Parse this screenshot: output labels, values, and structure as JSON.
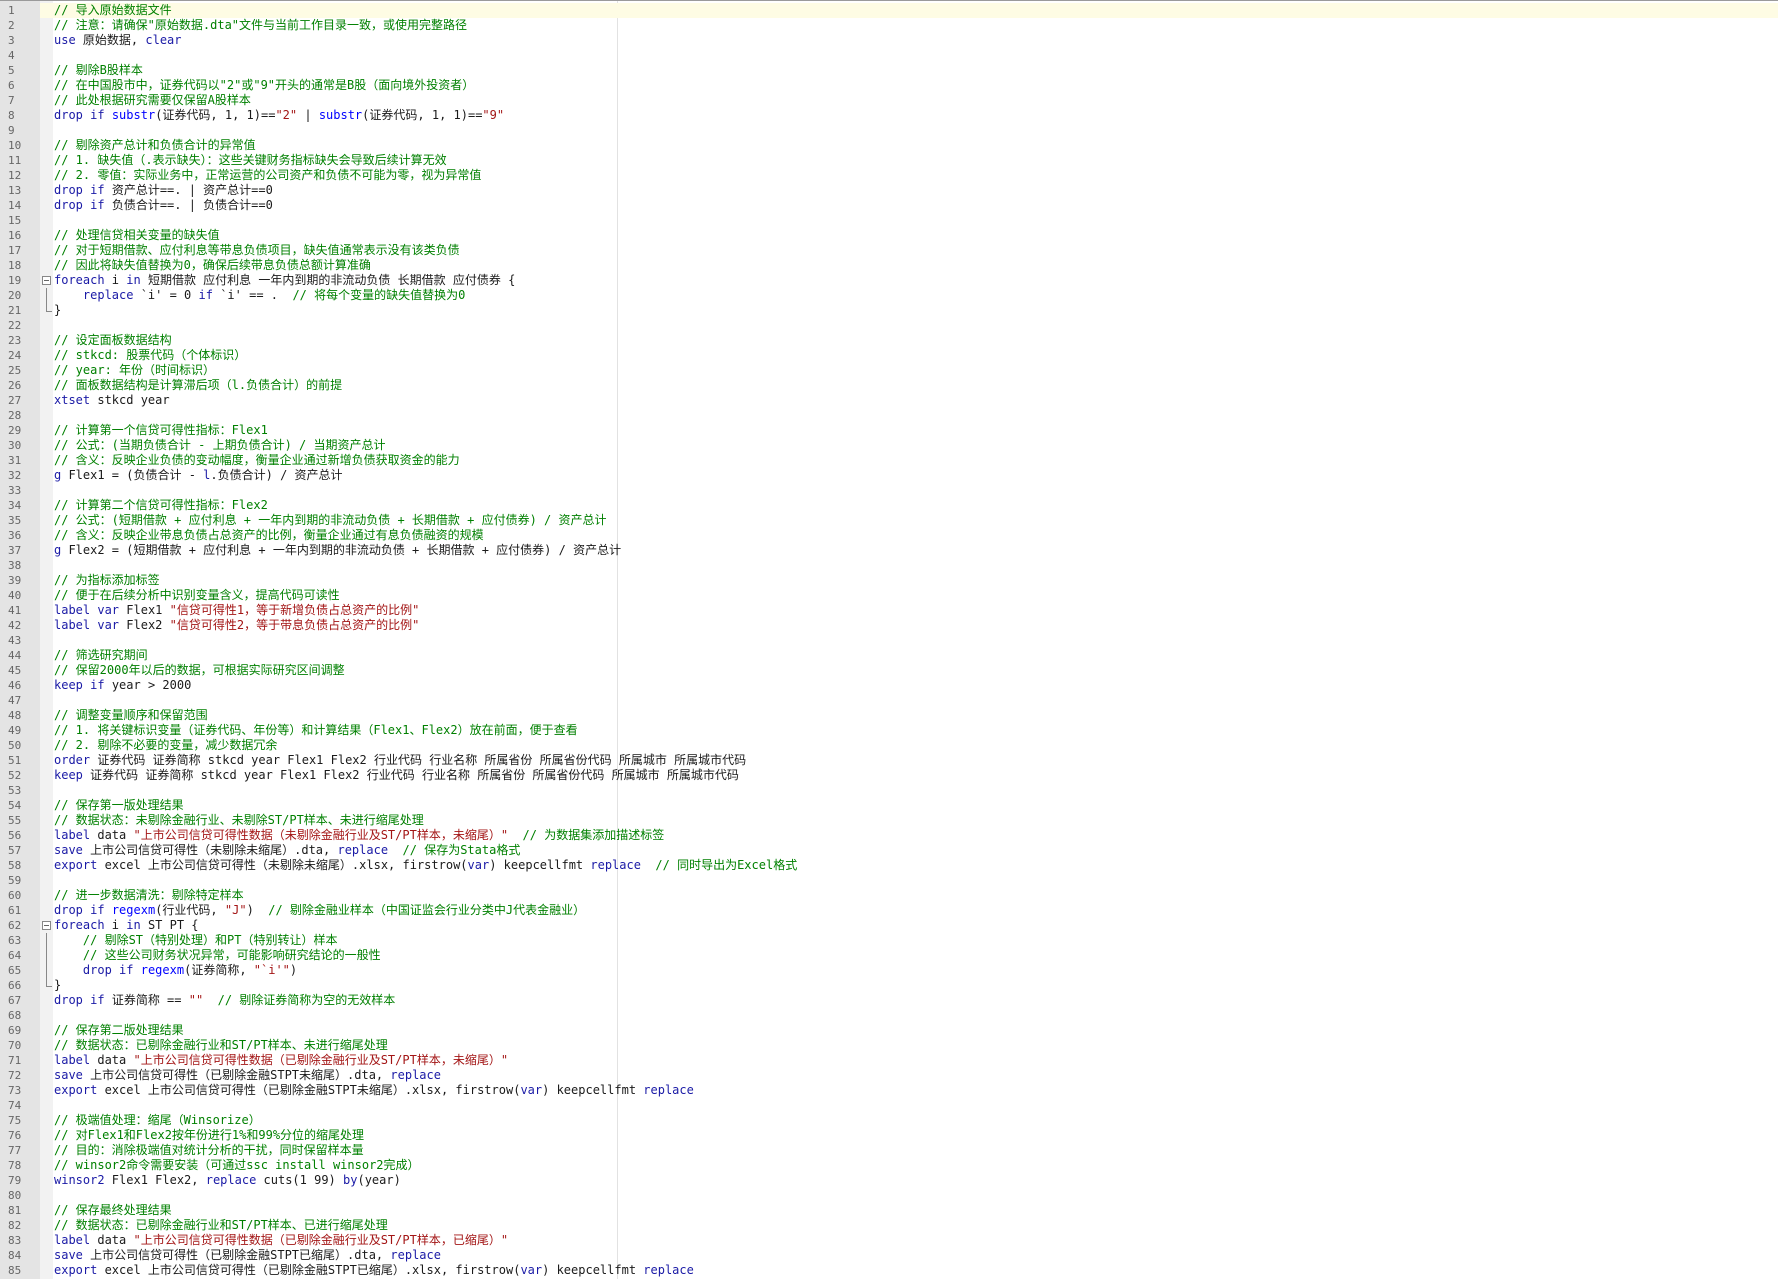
{
  "editor": {
    "colors": {
      "comment": "#008000",
      "keyword": "#1a1aa6",
      "function": "#0000ff",
      "string": "#a31515"
    },
    "current_line": 1
  },
  "lines": [
    {
      "n": "1",
      "segs": [
        [
          "c",
          "// 导入原始数据文件"
        ]
      ]
    },
    {
      "n": "2",
      "segs": [
        [
          "c",
          "// 注意：请确保\"原始数据.dta\"文件与当前工作目录一致，或使用完整路径"
        ]
      ]
    },
    {
      "n": "3",
      "segs": [
        [
          "k",
          "use"
        ],
        [
          "t",
          " 原始数据, "
        ],
        [
          "k",
          "clear"
        ]
      ]
    },
    {
      "n": "4",
      "segs": []
    },
    {
      "n": "5",
      "segs": [
        [
          "c",
          "// 剔除B股样本"
        ]
      ]
    },
    {
      "n": "6",
      "segs": [
        [
          "c",
          "// 在中国股市中，证券代码以\"2\"或\"9\"开头的通常是B股（面向境外投资者）"
        ]
      ]
    },
    {
      "n": "7",
      "segs": [
        [
          "c",
          "// 此处根据研究需要仅保留A股样本"
        ]
      ]
    },
    {
      "n": "8",
      "segs": [
        [
          "k",
          "drop"
        ],
        [
          "t",
          " "
        ],
        [
          "k",
          "if"
        ],
        [
          "t",
          " "
        ],
        [
          "f",
          "substr"
        ],
        [
          "t",
          "(证券代码, 1, 1)=="
        ],
        [
          "s",
          "\"2\""
        ],
        [
          "t",
          " | "
        ],
        [
          "f",
          "substr"
        ],
        [
          "t",
          "(证券代码, 1, 1)=="
        ],
        [
          "s",
          "\"9\""
        ]
      ]
    },
    {
      "n": "9",
      "segs": []
    },
    {
      "n": "10",
      "segs": [
        [
          "c",
          "// 剔除资产总计和负债合计的异常值"
        ]
      ]
    },
    {
      "n": "11",
      "segs": [
        [
          "c",
          "// 1. 缺失值（.表示缺失）：这些关键财务指标缺失会导致后续计算无效"
        ]
      ]
    },
    {
      "n": "12",
      "segs": [
        [
          "c",
          "// 2. 零值：实际业务中，正常运营的公司资产和负债不可能为零，视为异常值"
        ]
      ]
    },
    {
      "n": "13",
      "segs": [
        [
          "k",
          "drop"
        ],
        [
          "t",
          " "
        ],
        [
          "k",
          "if"
        ],
        [
          "t",
          " 资产总计==. | 资产总计==0"
        ]
      ]
    },
    {
      "n": "14",
      "segs": [
        [
          "k",
          "drop"
        ],
        [
          "t",
          " "
        ],
        [
          "k",
          "if"
        ],
        [
          "t",
          " 负债合计==. | 负债合计==0"
        ]
      ]
    },
    {
      "n": "15",
      "segs": []
    },
    {
      "n": "16",
      "segs": [
        [
          "c",
          "// 处理信贷相关变量的缺失值"
        ]
      ]
    },
    {
      "n": "17",
      "segs": [
        [
          "c",
          "// 对于短期借款、应付利息等带息负债项目，缺失值通常表示没有该类负债"
        ]
      ]
    },
    {
      "n": "18",
      "segs": [
        [
          "c",
          "// 因此将缺失值替换为0，确保后续带息负债总额计算准确"
        ]
      ]
    },
    {
      "n": "19",
      "fold": "start",
      "segs": [
        [
          "k",
          "foreach"
        ],
        [
          "t",
          " i "
        ],
        [
          "k",
          "in"
        ],
        [
          "t",
          " 短期借款 应付利息 一年内到期的非流动负债 长期借款 应付债券 {"
        ]
      ]
    },
    {
      "n": "20",
      "fold": "mid",
      "segs": [
        [
          "t",
          "    "
        ],
        [
          "k",
          "replace"
        ],
        [
          "t",
          " `i' = 0 "
        ],
        [
          "k",
          "if"
        ],
        [
          "t",
          " `i' == .  "
        ],
        [
          "c",
          "// 将每个变量的缺失值替换为0"
        ]
      ]
    },
    {
      "n": "21",
      "fold": "end",
      "segs": [
        [
          "t",
          "}"
        ]
      ]
    },
    {
      "n": "22",
      "segs": []
    },
    {
      "n": "23",
      "segs": [
        [
          "c",
          "// 设定面板数据结构"
        ]
      ]
    },
    {
      "n": "24",
      "segs": [
        [
          "c",
          "// stkcd: 股票代码（个体标识）"
        ]
      ]
    },
    {
      "n": "25",
      "segs": [
        [
          "c",
          "// year: 年份（时间标识）"
        ]
      ]
    },
    {
      "n": "26",
      "segs": [
        [
          "c",
          "// 面板数据结构是计算滞后项（l.负债合计）的前提"
        ]
      ]
    },
    {
      "n": "27",
      "segs": [
        [
          "k",
          "xtset"
        ],
        [
          "t",
          " stkcd year"
        ]
      ]
    },
    {
      "n": "28",
      "segs": []
    },
    {
      "n": "29",
      "segs": [
        [
          "c",
          "// 计算第一个信贷可得性指标：Flex1"
        ]
      ]
    },
    {
      "n": "30",
      "segs": [
        [
          "c",
          "// 公式：(当期负债合计 - 上期负债合计) / 当期资产总计"
        ]
      ]
    },
    {
      "n": "31",
      "segs": [
        [
          "c",
          "// 含义：反映企业负债的变动幅度，衡量企业通过新增负债获取资金的能力"
        ]
      ]
    },
    {
      "n": "32",
      "segs": [
        [
          "k",
          "g"
        ],
        [
          "t",
          " Flex1 = (负债合计 - "
        ],
        [
          "k",
          "l"
        ],
        [
          "t",
          ".负债合计) / 资产总计"
        ]
      ]
    },
    {
      "n": "33",
      "segs": []
    },
    {
      "n": "34",
      "segs": [
        [
          "c",
          "// 计算第二个信贷可得性指标：Flex2"
        ]
      ]
    },
    {
      "n": "35",
      "segs": [
        [
          "c",
          "// 公式：(短期借款 + 应付利息 + 一年内到期的非流动负债 + 长期借款 + 应付债券) / 资产总计"
        ]
      ]
    },
    {
      "n": "36",
      "segs": [
        [
          "c",
          "// 含义：反映企业带息负债占总资产的比例，衡量企业通过有息负债融资的规模"
        ]
      ]
    },
    {
      "n": "37",
      "segs": [
        [
          "k",
          "g"
        ],
        [
          "t",
          " Flex2 = (短期借款 + 应付利息 + 一年内到期的非流动负债 + 长期借款 + 应付债券) / 资产总计"
        ]
      ]
    },
    {
      "n": "38",
      "segs": []
    },
    {
      "n": "39",
      "segs": [
        [
          "c",
          "// 为指标添加标签"
        ]
      ]
    },
    {
      "n": "40",
      "segs": [
        [
          "c",
          "// 便于在后续分析中识别变量含义，提高代码可读性"
        ]
      ]
    },
    {
      "n": "41",
      "segs": [
        [
          "k",
          "label"
        ],
        [
          "t",
          " "
        ],
        [
          "k",
          "var"
        ],
        [
          "t",
          " Flex1 "
        ],
        [
          "s",
          "\"信贷可得性1，等于新增负债占总资产的比例\""
        ]
      ]
    },
    {
      "n": "42",
      "segs": [
        [
          "k",
          "label"
        ],
        [
          "t",
          " "
        ],
        [
          "k",
          "var"
        ],
        [
          "t",
          " Flex2 "
        ],
        [
          "s",
          "\"信贷可得性2，等于带息负债占总资产的比例\""
        ]
      ]
    },
    {
      "n": "43",
      "segs": []
    },
    {
      "n": "44",
      "segs": [
        [
          "c",
          "// 筛选研究期间"
        ]
      ]
    },
    {
      "n": "45",
      "segs": [
        [
          "c",
          "// 保留2000年以后的数据，可根据实际研究区间调整"
        ]
      ]
    },
    {
      "n": "46",
      "segs": [
        [
          "k",
          "keep"
        ],
        [
          "t",
          " "
        ],
        [
          "k",
          "if"
        ],
        [
          "t",
          " year > 2000"
        ]
      ]
    },
    {
      "n": "47",
      "segs": []
    },
    {
      "n": "48",
      "segs": [
        [
          "c",
          "// 调整变量顺序和保留范围"
        ]
      ]
    },
    {
      "n": "49",
      "segs": [
        [
          "c",
          "// 1. 将关键标识变量（证券代码、年份等）和计算结果（Flex1、Flex2）放在前面，便于查看"
        ]
      ]
    },
    {
      "n": "50",
      "segs": [
        [
          "c",
          "// 2. 剔除不必要的变量，减少数据冗余"
        ]
      ]
    },
    {
      "n": "51",
      "segs": [
        [
          "k",
          "order"
        ],
        [
          "t",
          " 证券代码 证券简称 stkcd year Flex1 Flex2 行业代码 行业名称 所属省份 所属省份代码 所属城市 所属城市代码"
        ]
      ]
    },
    {
      "n": "52",
      "segs": [
        [
          "k",
          "keep"
        ],
        [
          "t",
          " 证券代码 证券简称 stkcd year Flex1 Flex2 行业代码 行业名称 所属省份 所属省份代码 所属城市 所属城市代码"
        ]
      ]
    },
    {
      "n": "53",
      "segs": []
    },
    {
      "n": "54",
      "segs": [
        [
          "c",
          "// 保存第一版处理结果"
        ]
      ]
    },
    {
      "n": "55",
      "segs": [
        [
          "c",
          "// 数据状态：未剔除金融行业、未剔除ST/PT样本、未进行缩尾处理"
        ]
      ]
    },
    {
      "n": "56",
      "segs": [
        [
          "k",
          "label"
        ],
        [
          "t",
          " data "
        ],
        [
          "s",
          "\"上市公司信贷可得性数据（未剔除金融行业及ST/PT样本，未缩尾）\""
        ],
        [
          "t",
          "  "
        ],
        [
          "c",
          "// 为数据集添加描述标签"
        ]
      ]
    },
    {
      "n": "57",
      "segs": [
        [
          "k",
          "save"
        ],
        [
          "t",
          " 上市公司信贷可得性（未剔除未缩尾）.dta, "
        ],
        [
          "k",
          "replace"
        ],
        [
          "t",
          "  "
        ],
        [
          "c",
          "// 保存为Stata格式"
        ]
      ]
    },
    {
      "n": "58",
      "segs": [
        [
          "k",
          "export"
        ],
        [
          "t",
          " excel 上市公司信贷可得性（未剔除未缩尾）.xlsx, firstrow("
        ],
        [
          "k",
          "var"
        ],
        [
          "t",
          ") keepcellfmt "
        ],
        [
          "k",
          "replace"
        ],
        [
          "t",
          "  "
        ],
        [
          "c",
          "// 同时导出为Excel格式"
        ]
      ]
    },
    {
      "n": "59",
      "segs": []
    },
    {
      "n": "60",
      "segs": [
        [
          "c",
          "// 进一步数据清洗：剔除特定样本"
        ]
      ]
    },
    {
      "n": "61",
      "segs": [
        [
          "k",
          "drop"
        ],
        [
          "t",
          " "
        ],
        [
          "k",
          "if"
        ],
        [
          "t",
          " "
        ],
        [
          "f",
          "regexm"
        ],
        [
          "t",
          "(行业代码, "
        ],
        [
          "s",
          "\"J\""
        ],
        [
          "t",
          ")  "
        ],
        [
          "c",
          "// 剔除金融业样本（中国证监会行业分类中J代表金融业）"
        ]
      ]
    },
    {
      "n": "62",
      "fold": "start",
      "segs": [
        [
          "k",
          "foreach"
        ],
        [
          "t",
          " i "
        ],
        [
          "k",
          "in"
        ],
        [
          "t",
          " ST PT {"
        ]
      ]
    },
    {
      "n": "63",
      "fold": "mid",
      "segs": [
        [
          "t",
          "    "
        ],
        [
          "c",
          "// 剔除ST（特别处理）和PT（特别转让）样本"
        ]
      ]
    },
    {
      "n": "64",
      "fold": "mid",
      "segs": [
        [
          "t",
          "    "
        ],
        [
          "c",
          "// 这些公司财务状况异常，可能影响研究结论的一般性"
        ]
      ]
    },
    {
      "n": "65",
      "fold": "mid",
      "segs": [
        [
          "t",
          "    "
        ],
        [
          "k",
          "drop"
        ],
        [
          "t",
          " "
        ],
        [
          "k",
          "if"
        ],
        [
          "t",
          " "
        ],
        [
          "f",
          "regexm"
        ],
        [
          "t",
          "(证券简称, "
        ],
        [
          "s",
          "\"`i'\""
        ],
        [
          "t",
          ")"
        ]
      ]
    },
    {
      "n": "66",
      "fold": "end",
      "segs": [
        [
          "t",
          "}"
        ]
      ]
    },
    {
      "n": "67",
      "segs": [
        [
          "k",
          "drop"
        ],
        [
          "t",
          " "
        ],
        [
          "k",
          "if"
        ],
        [
          "t",
          " 证券简称 == "
        ],
        [
          "s",
          "\"\""
        ],
        [
          "t",
          "  "
        ],
        [
          "c",
          "// 剔除证券简称为空的无效样本"
        ]
      ]
    },
    {
      "n": "68",
      "segs": []
    },
    {
      "n": "69",
      "segs": [
        [
          "c",
          "// 保存第二版处理结果"
        ]
      ]
    },
    {
      "n": "70",
      "segs": [
        [
          "c",
          "// 数据状态：已剔除金融行业和ST/PT样本、未进行缩尾处理"
        ]
      ]
    },
    {
      "n": "71",
      "segs": [
        [
          "k",
          "label"
        ],
        [
          "t",
          " data "
        ],
        [
          "s",
          "\"上市公司信贷可得性数据（已剔除金融行业及ST/PT样本，未缩尾）\""
        ]
      ]
    },
    {
      "n": "72",
      "segs": [
        [
          "k",
          "save"
        ],
        [
          "t",
          " 上市公司信贷可得性（已剔除金融STPT未缩尾）.dta, "
        ],
        [
          "k",
          "replace"
        ]
      ]
    },
    {
      "n": "73",
      "segs": [
        [
          "k",
          "export"
        ],
        [
          "t",
          " excel 上市公司信贷可得性（已剔除金融STPT未缩尾）.xlsx, firstrow("
        ],
        [
          "k",
          "var"
        ],
        [
          "t",
          ") keepcellfmt "
        ],
        [
          "k",
          "replace"
        ]
      ]
    },
    {
      "n": "74",
      "segs": []
    },
    {
      "n": "75",
      "segs": [
        [
          "c",
          "// 极端值处理：缩尾（Winsorize）"
        ]
      ]
    },
    {
      "n": "76",
      "segs": [
        [
          "c",
          "// 对Flex1和Flex2按年份进行1%和99%分位的缩尾处理"
        ]
      ]
    },
    {
      "n": "77",
      "segs": [
        [
          "c",
          "// 目的：消除极端值对统计分析的干扰，同时保留样本量"
        ]
      ]
    },
    {
      "n": "78",
      "segs": [
        [
          "c",
          "// winsor2命令需要安装（可通过ssc install winsor2完成）"
        ]
      ]
    },
    {
      "n": "79",
      "segs": [
        [
          "k",
          "winsor2"
        ],
        [
          "t",
          " Flex1 Flex2, "
        ],
        [
          "k",
          "replace"
        ],
        [
          "t",
          " cuts(1 99) "
        ],
        [
          "k",
          "by"
        ],
        [
          "t",
          "(year)"
        ]
      ]
    },
    {
      "n": "80",
      "segs": []
    },
    {
      "n": "81",
      "segs": [
        [
          "c",
          "// 保存最终处理结果"
        ]
      ]
    },
    {
      "n": "82",
      "segs": [
        [
          "c",
          "// 数据状态：已剔除金融行业和ST/PT样本、已进行缩尾处理"
        ]
      ]
    },
    {
      "n": "83",
      "segs": [
        [
          "k",
          "label"
        ],
        [
          "t",
          " data "
        ],
        [
          "s",
          "\"上市公司信贷可得性数据（已剔除金融行业及ST/PT样本，已缩尾）\""
        ]
      ]
    },
    {
      "n": "84",
      "segs": [
        [
          "k",
          "save"
        ],
        [
          "t",
          " 上市公司信贷可得性（已剔除金融STPT已缩尾）.dta, "
        ],
        [
          "k",
          "replace"
        ]
      ]
    },
    {
      "n": "85",
      "segs": [
        [
          "k",
          "export"
        ],
        [
          "t",
          " excel 上市公司信贷可得性（已剔除金融STPT已缩尾）.xlsx, firstrow("
        ],
        [
          "k",
          "var"
        ],
        [
          "t",
          ") keepcellfmt "
        ],
        [
          "k",
          "replace"
        ]
      ]
    }
  ]
}
